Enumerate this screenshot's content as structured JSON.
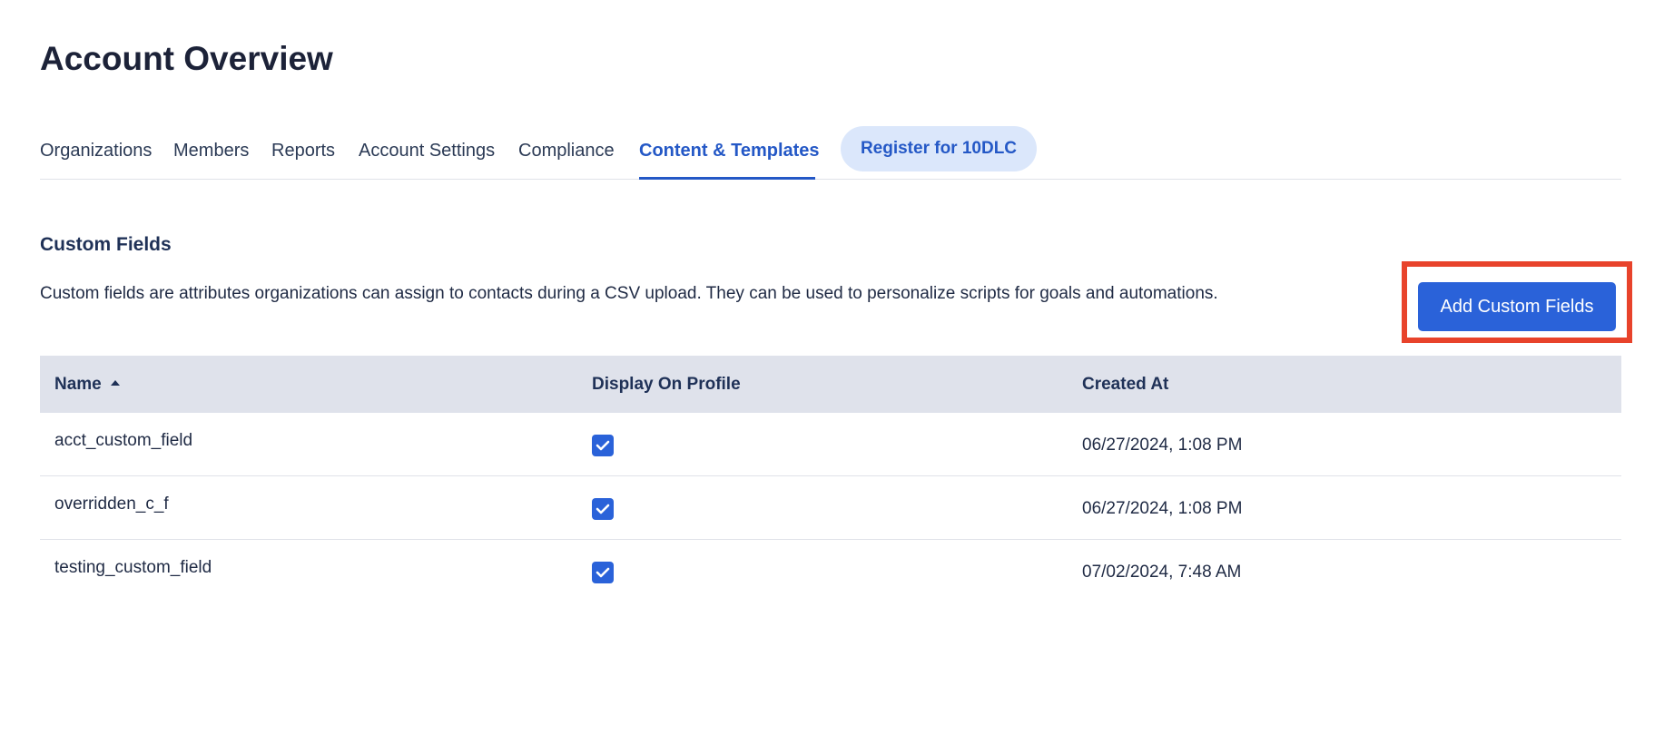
{
  "page": {
    "title": "Account Overview"
  },
  "tabs": {
    "items": [
      {
        "label": "Organizations",
        "active": false
      },
      {
        "label": "Members",
        "active": false
      },
      {
        "label": "Reports",
        "active": false
      },
      {
        "label": "Account Settings",
        "active": false
      },
      {
        "label": "Compliance",
        "active": false
      },
      {
        "label": "Content & Templates",
        "active": true
      }
    ],
    "register_label": "Register for 10DLC"
  },
  "section": {
    "title": "Custom Fields",
    "description": "Custom fields are attributes organizations can assign to contacts during a CSV upload. They can be used to personalize scripts for goals and automations.",
    "add_button_label": "Add Custom Fields"
  },
  "table": {
    "columns": [
      "Name",
      "Display On Profile",
      "Created At"
    ],
    "sort_icon": "sort-ascending-icon",
    "rows": [
      {
        "name": "acct_custom_field",
        "display_on_profile": true,
        "created_at": "06/27/2024, 1:08 PM"
      },
      {
        "name": "overridden_c_f",
        "display_on_profile": true,
        "created_at": "06/27/2024, 1:08 PM"
      },
      {
        "name": "testing_custom_field",
        "display_on_profile": true,
        "created_at": "07/02/2024, 7:48 AM"
      }
    ]
  },
  "colors": {
    "accent": "#2458c6",
    "button": "#2a62d9",
    "highlight": "#e8432b",
    "table_header_bg": "#dfe2eb",
    "pill_bg": "#dbe7fb"
  }
}
